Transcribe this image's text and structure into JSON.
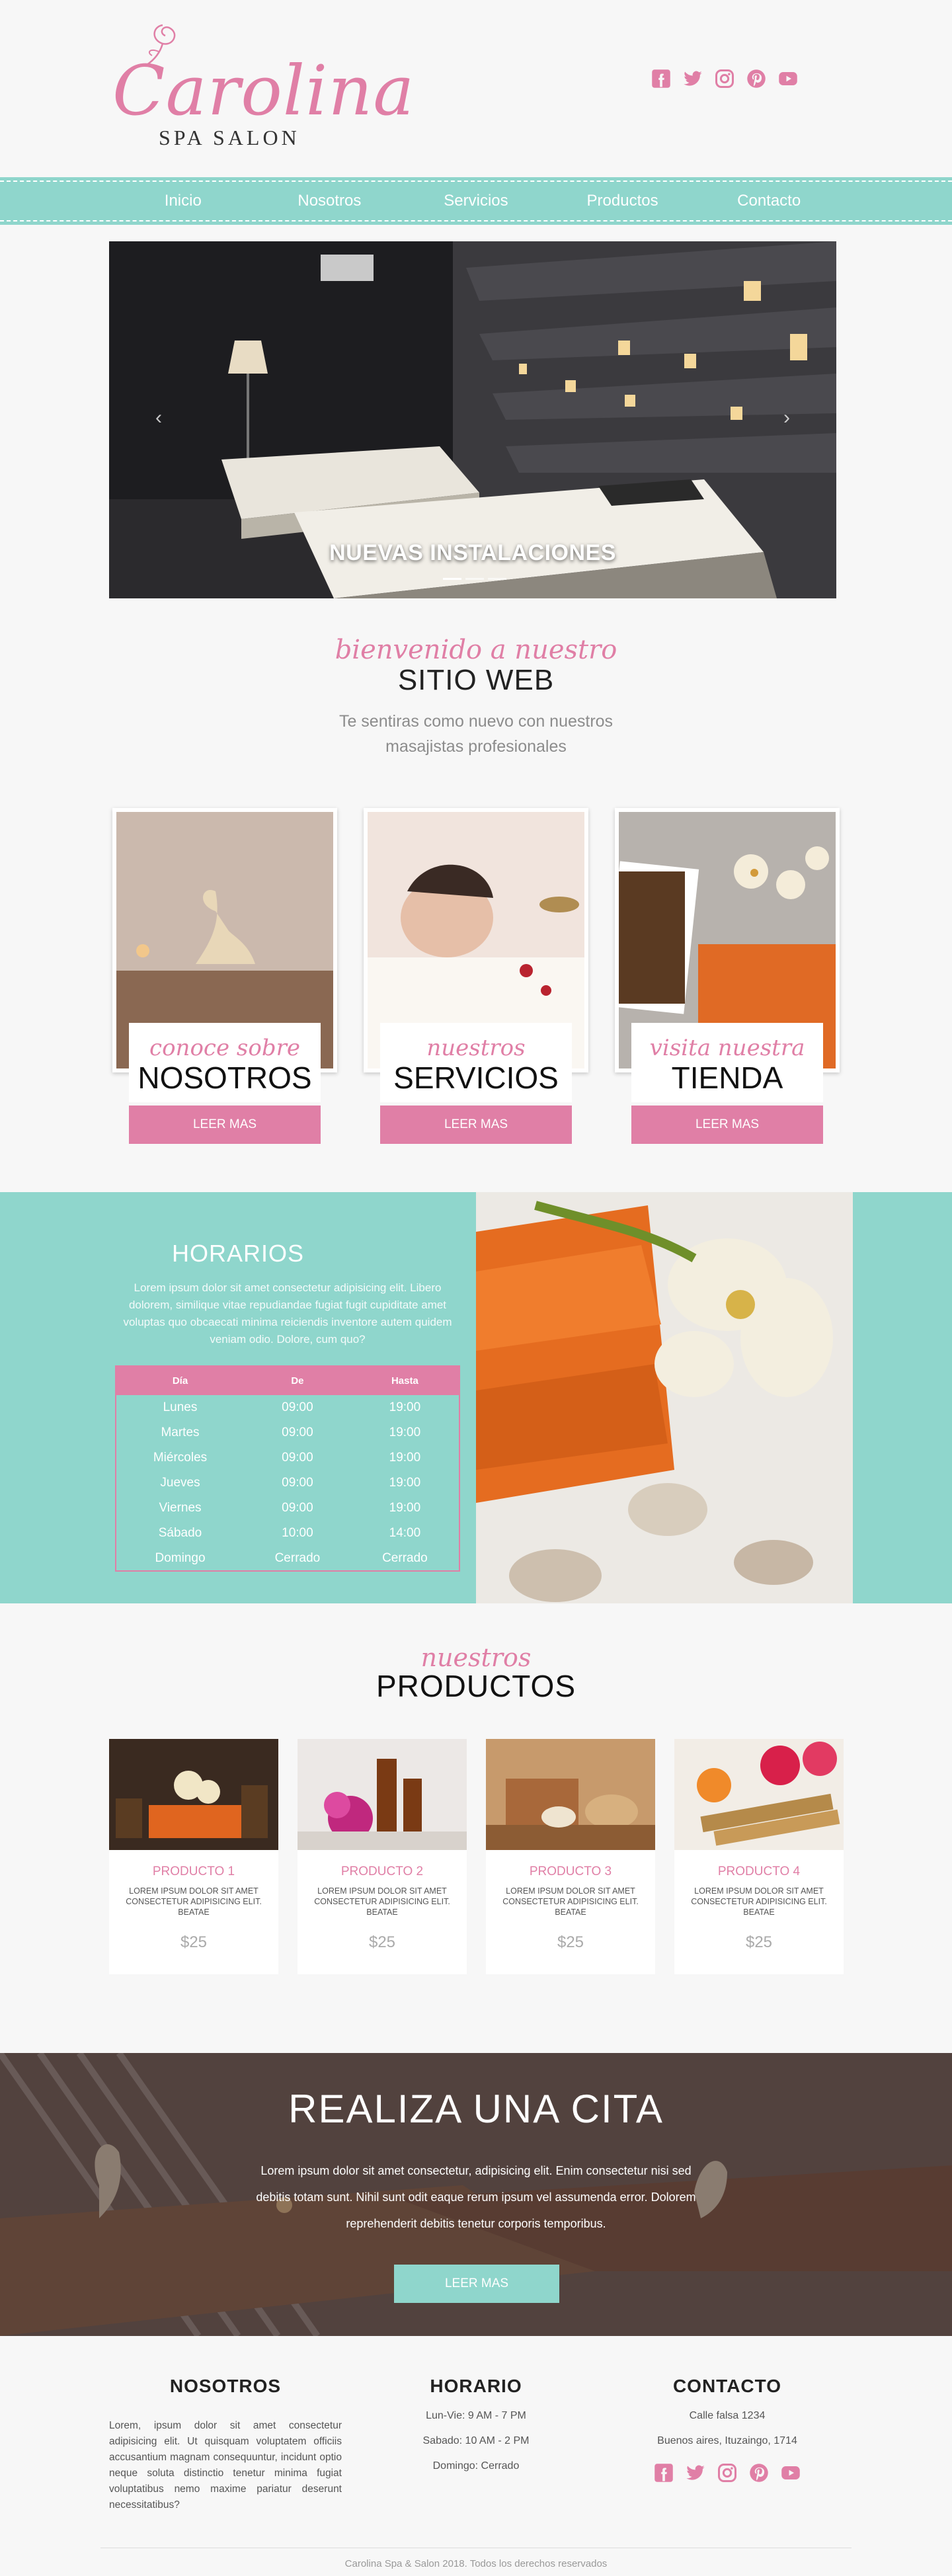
{
  "brand": {
    "name": "Carolina",
    "sub": "SPA SALON"
  },
  "social": [
    "facebook-icon",
    "twitter-icon",
    "instagram-icon",
    "pinterest-icon",
    "youtube-icon"
  ],
  "nav": [
    "Inicio",
    "Nosotros",
    "Servicios",
    "Productos",
    "Contacto"
  ],
  "slider": {
    "caption": "NUEVAS INSTALACIONES",
    "prev": "‹",
    "next": "›"
  },
  "welcome": {
    "script": "bienvenido a nuestro",
    "title": "SITIO WEB",
    "line1": "Te sentiras como nuevo con nuestros",
    "line2": "masajistas profesionales"
  },
  "cards": [
    {
      "script": "conoce sobre",
      "title": "NOSOTROS",
      "button": "LEER MAS"
    },
    {
      "script": "nuestros",
      "title": "SERVICIOS",
      "button": "LEER MAS"
    },
    {
      "script": "visita nuestra",
      "title": "TIENDA",
      "button": "LEER MAS"
    }
  ],
  "hours": {
    "title": "HORARIOS",
    "lorem": "Lorem ipsum dolor sit amet consectetur adipisicing elit. Libero dolorem, similique vitae repudiandae fugiat fugit cupiditate amet voluptas quo obcaecati minima reiciendis inventore autem quidem veniam odio. Dolore, cum quo?",
    "headers": [
      "Día",
      "De",
      "Hasta"
    ],
    "rows": [
      [
        "Lunes",
        "09:00",
        "19:00"
      ],
      [
        "Martes",
        "09:00",
        "19:00"
      ],
      [
        "Miércoles",
        "09:00",
        "19:00"
      ],
      [
        "Jueves",
        "09:00",
        "19:00"
      ],
      [
        "Viernes",
        "09:00",
        "19:00"
      ],
      [
        "Sábado",
        "10:00",
        "14:00"
      ],
      [
        "Domingo",
        "Cerrado",
        "Cerrado"
      ]
    ]
  },
  "products_head": {
    "script": "nuestros",
    "title": "PRODUCTOS"
  },
  "products": [
    {
      "name": "PRODUCTO 1",
      "desc": "LOREM IPSUM DOLOR SIT AMET CONSECTETUR ADIPISICING ELIT. BEATAE",
      "price": "$25"
    },
    {
      "name": "PRODUCTO 2",
      "desc": "LOREM IPSUM DOLOR SIT AMET CONSECTETUR ADIPISICING ELIT. BEATAE",
      "price": "$25"
    },
    {
      "name": "PRODUCTO 3",
      "desc": "LOREM IPSUM DOLOR SIT AMET CONSECTETUR ADIPISICING ELIT. BEATAE",
      "price": "$25"
    },
    {
      "name": "PRODUCTO 4",
      "desc": "LOREM IPSUM DOLOR SIT AMET CONSECTETUR ADIPISICING ELIT. BEATAE",
      "price": "$25"
    }
  ],
  "cita": {
    "title": "REALIZA UNA CITA",
    "text": "Lorem ipsum dolor sit amet consectetur, adipisicing elit. Enim consectetur nisi sed debitis totam sunt. Nihil sunt odit eaque rerum ipsum vel assumenda error. Dolorem reprehenderit debitis tenetur corporis temporibus.",
    "button": "LEER MAS"
  },
  "footer": {
    "nosotros_title": "NOSOTROS",
    "nosotros_text": "Lorem, ipsum dolor sit amet consectetur adipisicing elit. Ut quisquam voluptatem officiis accusantium magnam consequuntur, incidunt optio neque soluta distinctio tenetur minima fugiat voluptatibus nemo maxime pariatur deserunt necessitatibus?",
    "horario_title": "HORARIO",
    "horario": [
      "Lun-Vie: 9 AM - 7 PM",
      "Sabado: 10 AM - 2 PM",
      "Domingo: Cerrado"
    ],
    "contacto_title": "CONTACTO",
    "contacto": [
      "Calle falsa 1234",
      "Buenos aires, Ituzaingo, 1714"
    ],
    "copyright": "Carolina Spa & Salon 2018. Todos los derechos reservados"
  },
  "colors": {
    "pink": "#e07fa6",
    "teal": "#8fd6cc"
  }
}
